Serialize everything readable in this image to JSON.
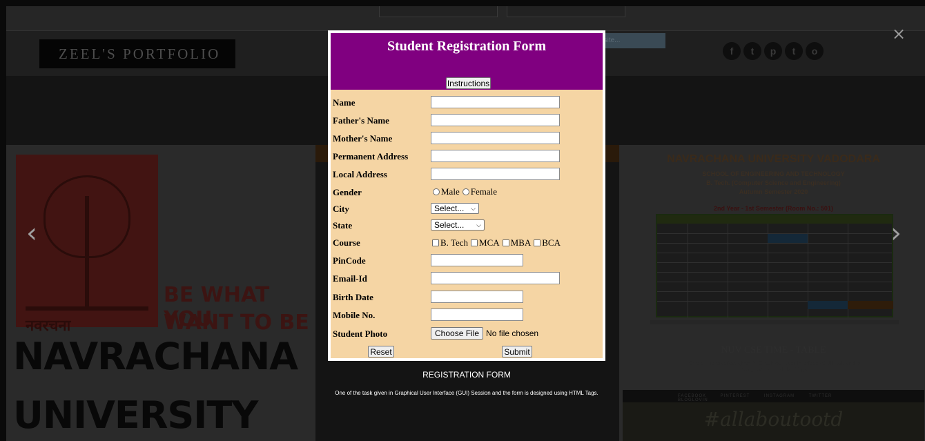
{
  "background": {
    "logo_text": "ZEEL'S PORTFOLIO",
    "search_text": "Search for the site...",
    "social_icons": [
      "f",
      "t",
      "p",
      "t",
      "o"
    ],
    "slide_left": {
      "devanagari": "नवरचना",
      "line1": "BE WHAT YOU",
      "line2": "WANT TO BE",
      "big1": "NAVRACHANA",
      "big2": "UNIVERSITY"
    },
    "slide_right": {
      "title": "NAVRACHANA UNIVERSITY VADODARA",
      "sub1": "SCHOOL OF ENGINEERING AND TECHNOLOGY",
      "sub2": "B. Tech. (Computer Science and Engineering)",
      "sub3": "Autumn Semester 2020",
      "sem": "2nd Year - 1st Semester (Room No.: 501)",
      "caption": "NUV CSE TIME - TABLE",
      "desc": "One of the practical given in Graphical User Interface (GUI) Lab and is designed using HTML Tags."
    },
    "footer_links": "FACEBOOK PINTEREST INSTAGRAM TWITTER BLOGLOVIN",
    "hashtag": "#allaboutootd"
  },
  "nav": {
    "prev_icon": "chevron-left-icon",
    "next_icon": "chevron-right-icon",
    "close_icon": "close-icon",
    "prev_glyph": "‹",
    "next_glyph": "›",
    "close_glyph": "×"
  },
  "form": {
    "title": "Student Registration Form",
    "instructions_button": "Instructions",
    "fields": {
      "name": "Name",
      "fathers_name": "Father's Name",
      "mothers_name": "Mother's Name",
      "permanent_address": "Permanent Address",
      "local_address": "Local Address",
      "gender": "Gender",
      "city": "City",
      "state": "State",
      "course": "Course",
      "pincode": "PinCode",
      "email": "Email-Id",
      "birth_date": "Birth Date",
      "mobile": "Mobile No.",
      "photo": "Student Photo"
    },
    "gender_options": [
      "Male",
      "Female"
    ],
    "city_selected": "Select...",
    "state_selected": "Select...",
    "course_options": [
      "B. Tech",
      "MCA",
      "MBA",
      "BCA"
    ],
    "file_button": "Choose File",
    "file_status": "No file chosen",
    "reset_button": "Reset",
    "submit_button": "Submit"
  },
  "caption": {
    "title": "REGISTRATION FORM",
    "description": "One of the task given in Graphical User Interface (GUI) Session and the form is designed using HTML Tags."
  },
  "colors": {
    "form_header": "#800080",
    "form_body": "#f5d5a4"
  }
}
